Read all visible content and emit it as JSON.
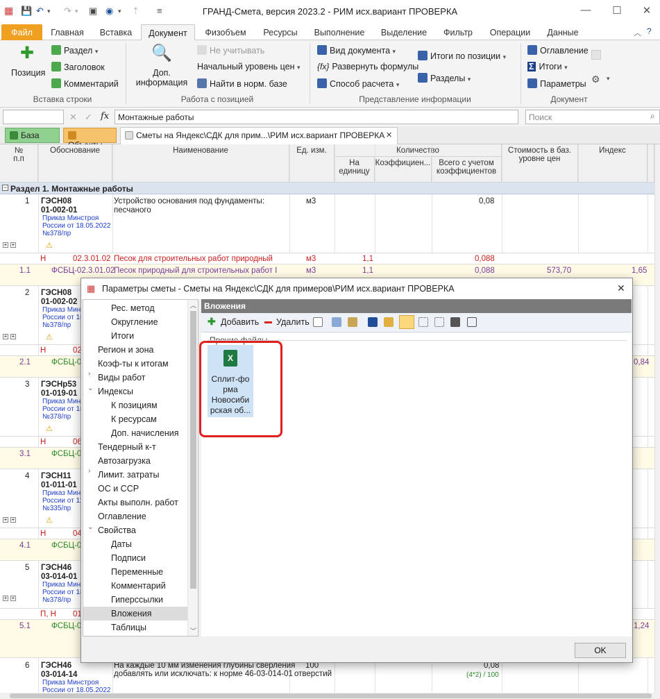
{
  "window": {
    "title": "ГРАНД-Смета, версия 2023.2 - РИМ исх.вариант ПРОВЕРКА"
  },
  "menu_tabs": [
    "Файл",
    "Главная",
    "Вставка",
    "Документ",
    "Физобъем",
    "Ресурсы",
    "Выполнение",
    "Выделение",
    "Фильтр",
    "Операции",
    "Данные"
  ],
  "ribbon": {
    "insert_row": {
      "label": "Вставка строки",
      "position": "Позиция",
      "section": "Раздел",
      "heading": "Заголовок",
      "comment": "Комментарий"
    },
    "position_work": {
      "label": "Работа с позицией",
      "extra_info_1": "Доп.",
      "extra_info_2": "информация",
      "ignore": "Не учитывать",
      "price_level": "Начальный уровень цен",
      "find_norm": "Найти в норм. базе"
    },
    "info_view": {
      "label": "Представление информации",
      "doc_view": "Вид документа",
      "expand_formulas": "Развернуть формулы",
      "calc_method": "Способ расчета",
      "totals_by_pos": "Итоги по позиции",
      "sections": "Разделы"
    },
    "document": {
      "label": "Документ",
      "toc": "Оглавление",
      "totals": "Итоги",
      "params": "Параметры"
    }
  },
  "formula_bar": {
    "value": "Монтажные работы",
    "search_placeholder": "Поиск"
  },
  "doc_tabs": {
    "base": "База",
    "objects": "Объекты",
    "current": "Сметы на Яндекс\\СДК для прим...\\РИМ исх.вариант ПРОВЕРКА"
  },
  "table": {
    "headers": {
      "num": "№\nп.п",
      "basis": "Обоснование",
      "name": "Наименование",
      "unit": "Ед. изм.",
      "qty": "Количество",
      "per_unit": "На\nединицу",
      "coef": "Коэффициен...",
      "total_qty": "Всего с учетом\nкоэффициентов",
      "cost": "Стоимость в баз.\nуровне цен",
      "index": "Индекс"
    },
    "section": "Раздел 1. Монтажные работы",
    "rows": [
      {
        "num": "1",
        "code1": "ГЭСН08",
        "code2": "01-002-01",
        "note1": "Приказ Минстроя",
        "note2": "России от 18.05.2022",
        "note3": "№378/пр",
        "name1": "Устройство основания под фундаменты:",
        "name2": "песчаного",
        "unit": "м3",
        "total": "0,08"
      },
      {
        "flag": "Н",
        "code": "02.3.01.02",
        "name": "Песок для строительных работ природный",
        "unit": "м3",
        "per_unit": "1,1",
        "total": "0,088"
      },
      {
        "num": "1.1",
        "code": "ФСБЦ-02.3.01.02",
        "name": "Песок природный для строительных работ I",
        "unit": "м3",
        "per_unit": "1,1",
        "total": "0,088",
        "cost": "573,70",
        "index": "1,65"
      },
      {
        "num": "2",
        "code1": "ГЭСН08",
        "code2": "01-002-02",
        "note1": "Приказ Минстроя",
        "note2": "России от 18",
        "note3": "№378/пр"
      },
      {
        "flag": "Н",
        "code": "02"
      },
      {
        "num": "2.1",
        "code": "ФСБЦ-02",
        "index": "0,84"
      },
      {
        "num": "3",
        "code1": "ГЭСНр53",
        "code2": "01-019-01",
        "note1": "Приказ Минстроя",
        "note2": "России от 18",
        "note3": "№378/пр"
      },
      {
        "flag": "Н",
        "code": "06"
      },
      {
        "num": "3.1",
        "code": "ФСБЦ-06"
      },
      {
        "num": "4",
        "code1": "ГЭСН11",
        "code2": "01-011-01",
        "note1": "Приказ Минстроя",
        "note2": "России от 11",
        "note3": "№335/пр"
      },
      {
        "flag": "Н",
        "code": "04"
      },
      {
        "num": "4.1",
        "code": "ФСБЦ-04"
      },
      {
        "num": "5",
        "code1": "ГЭСН46",
        "code2": "03-014-01",
        "note1": "Приказ Минстроя",
        "note2": "России от 18",
        "note3": "№378/пр"
      },
      {
        "flag": "П, Н",
        "code": "01"
      },
      {
        "num": "5.1",
        "code": "ФСБЦ-01",
        "index": "1,24"
      },
      {
        "num": "6",
        "code1": "ГЭСН46",
        "code2": "03-014-14",
        "note1": "Приказ Минстроя",
        "note2": "России от 18.05.2022",
        "name1": "На каждые 10 мм изменения глубины сверления",
        "name2": "добавлять или исключать: к норме 46-03-014-01",
        "unit1": "100",
        "unit2": "отверстий",
        "total": "0,08",
        "formula": "(4*2) / 100"
      }
    ]
  },
  "dialog": {
    "title": "Параметры сметы - Сметы на Яндекс\\СДК для примеров\\РИМ исх.вариант ПРОВЕРКА",
    "tree": [
      "Рес. метод",
      "Округление",
      "Итоги",
      "Регион и зона",
      "Коэф-ты к итогам",
      "Виды работ",
      "Индексы",
      "К позициям",
      "К ресурсам",
      "Доп. начисления",
      "Тендерный к-т",
      "Автозагрузка",
      "Лимит. затраты",
      "ОС и ССР",
      "Акты выполн. работ",
      "Оглавление",
      "Свойства",
      "Даты",
      "Подписи",
      "Переменные",
      "Комментарий",
      "Гиперссылки",
      "Вложения",
      "Таблицы"
    ],
    "pane_title": "Вложения",
    "add": "Добавить",
    "delete": "Удалить",
    "group": "Прочие файлы",
    "file_lines": [
      "Сплит-фо",
      "рма",
      "Новосиби",
      "рская об..."
    ],
    "ok": "OK"
  },
  "colors": {
    "file_tab": "#f0a020",
    "section_row": "#dbe3ee",
    "resource_row": "#fffbe6",
    "highlight": "#e02020",
    "selected_file": "#cfe3f7"
  }
}
